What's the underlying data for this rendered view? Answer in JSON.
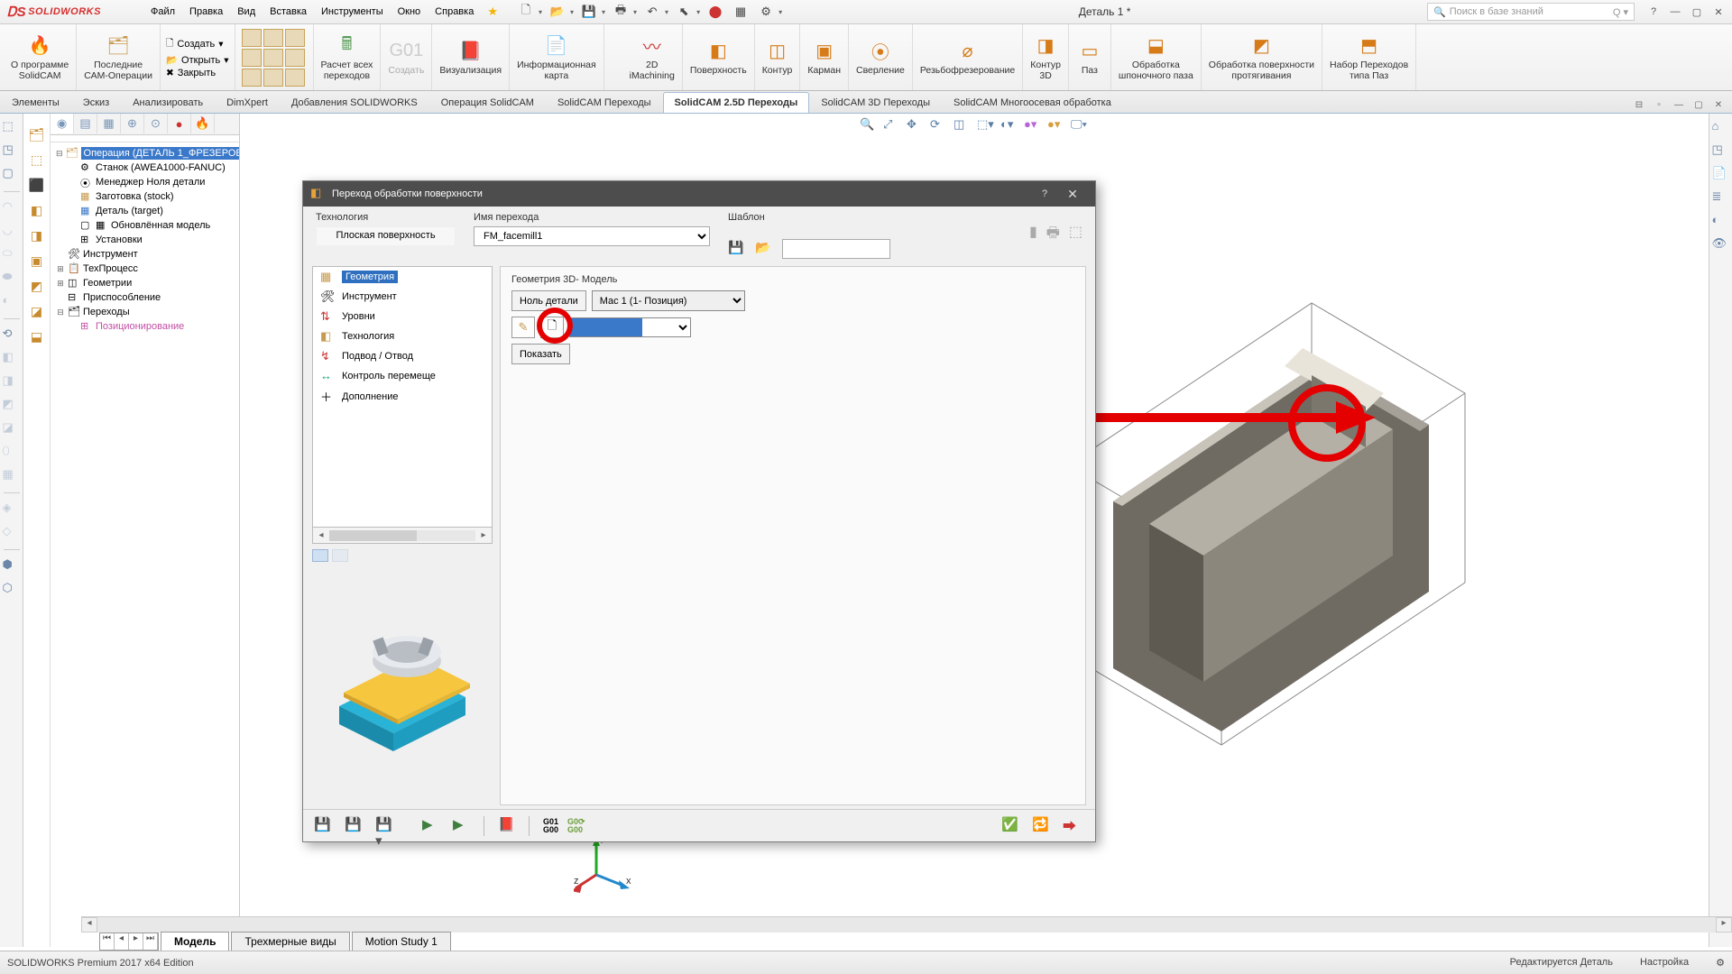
{
  "app": {
    "name": "SOLIDWORKS",
    "doc_title": "Деталь 1 *",
    "search_placeholder": "Поиск в базе знаний"
  },
  "menu": [
    "Файл",
    "Правка",
    "Вид",
    "Вставка",
    "Инструменты",
    "Окно",
    "Справка"
  ],
  "ribbon": {
    "grp1": "О программе\nSolidCAM",
    "grp2": "Последние\nСАМ-Операции",
    "create": "Создать",
    "open": "Открыть",
    "close": "Закрыть",
    "calc": "Расчет всех\nпереходов",
    "make": "Создать",
    "viz": "Визуализация",
    "info": "Информационная\nкарта",
    "twod": "2D\niMachining",
    "face": "Поверхность",
    "contour": "Контур",
    "pocket": "Карман",
    "drill": "Сверление",
    "thread": "Резьбофрезерование",
    "k3d": "Контур\n3D",
    "slot": "Паз",
    "keyway": "Обработка\nшпоночного паза",
    "surf": "Обработка поверхности\nпротягивания",
    "slotset": "Набор Переходов\nтипа Паз"
  },
  "tabs": [
    "Элементы",
    "Эскиз",
    "Анализировать",
    "DimXpert",
    "Добавления SOLIDWORKS",
    "Операция  SolidCAM",
    "SolidCAM Переходы",
    "SolidCAM 2.5D Переходы",
    "SolidCAM 3D Переходы",
    "SolidCAM Многоосевая обработка"
  ],
  "active_tab": 7,
  "tree": {
    "op": "Операция (ДЕТАЛЬ 1_ФРЕЗЕРОВ",
    "machine": "Станок (AWEA1000-FANUC)",
    "zero": "Менеджер Ноля детали",
    "stock": "Заготовка (stock)",
    "target": "Деталь (target)",
    "upd": "Обновлённая модель",
    "setup": "Установки",
    "tool": "Инструмент",
    "tech": "ТехПроцесс",
    "geom": "Геометрии",
    "fix": "Приспособление",
    "ops": "Переходы",
    "pos": "Позиционирование"
  },
  "dialog": {
    "title": "Переход обработки поверхности",
    "tech_label": "Технология",
    "tech_value": "Плоская поверхность",
    "name_label": "Имя перехода",
    "name_value": "FM_facemill1",
    "templ_label": "Шаблон",
    "nav": [
      "Геометрия",
      "Инструмент",
      "Уровни",
      "Технология",
      "Подвод / Отвод",
      "Контроль перемеще",
      "Дополнение"
    ],
    "grp": "Геометрия 3D- Модель",
    "zero_btn": "Ноль детали",
    "mac": "Mac 1 (1- Позиция)",
    "show": "Показать"
  },
  "bottom_tabs": [
    "Модель",
    "Трехмерные виды",
    "Motion Study 1"
  ],
  "status": {
    "left": "SOLIDWORKS Premium 2017 x64 Edition",
    "edit": "Редактируется Деталь",
    "custom": "Настройка"
  }
}
